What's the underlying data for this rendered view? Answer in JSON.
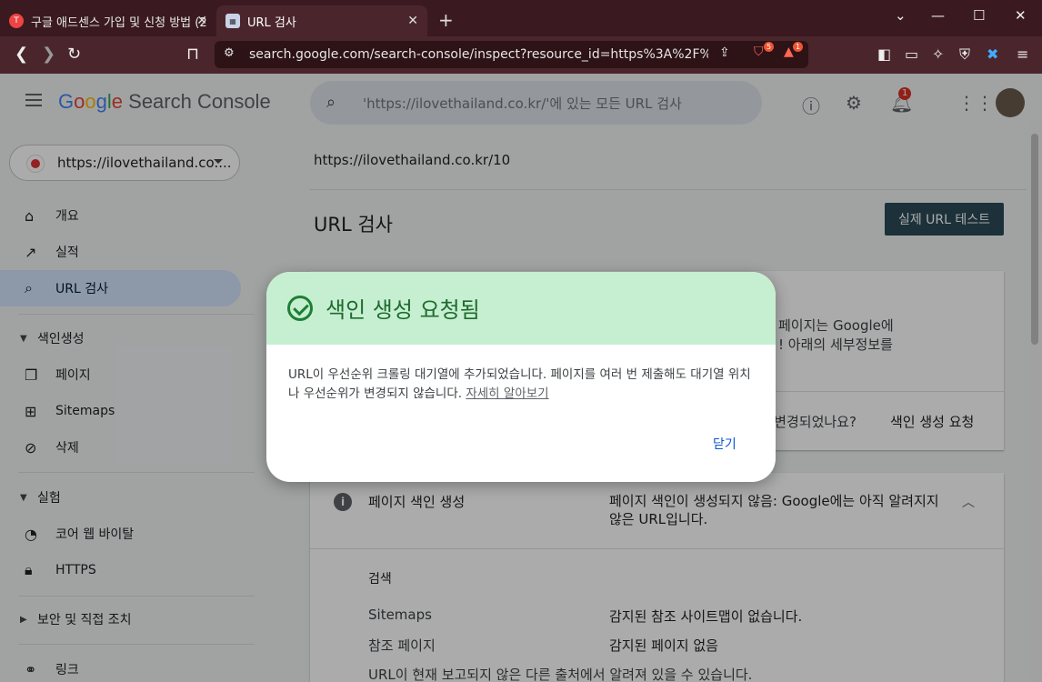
{
  "browser": {
    "tabs": [
      {
        "title": "구글 애드센스 가입 및 신청 방법 (2"
      },
      {
        "title": "URL 검사"
      }
    ],
    "url": "search.google.com/search-console/inspect?resource_id=https%3A%2F%2Filov...",
    "badges": {
      "brave": "5",
      "alert": "1"
    }
  },
  "header": {
    "logo_google": [
      "G",
      "o",
      "o",
      "g",
      "l",
      "e"
    ],
    "logo_product": "Search Console",
    "search_placeholder": "'https://ilovethailand.co.kr/'에 있는 모든 URL 검사",
    "notification_count": "1"
  },
  "sidebar": {
    "property": "https://ilovethailand.co....",
    "items": [
      {
        "label": "개요"
      },
      {
        "label": "실적"
      },
      {
        "label": "URL 검사"
      }
    ],
    "sections": [
      {
        "label": "색인생성",
        "items": [
          {
            "label": "페이지"
          },
          {
            "label": "Sitemaps"
          },
          {
            "label": "삭제"
          }
        ]
      },
      {
        "label": "실험",
        "items": [
          {
            "label": "코어 웹 바이탈"
          },
          {
            "label": "HTTPS"
          }
        ]
      },
      {
        "label": "보안 및 직접 조치"
      }
    ],
    "last_item": "링크"
  },
  "main": {
    "inspected_url": "https://ilovethailand.co.kr/10",
    "title": "URL 검사",
    "live_test_button": "실제 URL 테스트",
    "card1": {
      "partial_line1": "페이지는 Google에",
      "partial_line2": "! 아래의 세부정보를",
      "changed_question": "- 변경되었나요?",
      "request_indexing": "색인 생성 요청"
    },
    "card2": {
      "title": "페이지 색인 생성",
      "status": "페이지 색인이 생성되지 않음: Google에는 아직 알려지지 않은 URL입니다.",
      "section_label": "검색",
      "rows": [
        {
          "label": "Sitemaps",
          "value": "감지된 참조 사이트맵이 없습니다."
        },
        {
          "label": "참조 페이지",
          "value": "감지된 페이지 없음"
        }
      ],
      "footer_text": "URL이 현재 보고되지 않은 다른 출처에서 알려져 있을 수 있습니다."
    }
  },
  "dialog": {
    "title": "색인 생성 요청됨",
    "body": "URL이 우선순위 크롤링 대기열에 추가되었습니다. 페이지를 여러 번 제출해도 대기열 위치나 우선순위가 변경되지 않습니다.",
    "link": "자세히 알아보기",
    "close": "닫기"
  }
}
